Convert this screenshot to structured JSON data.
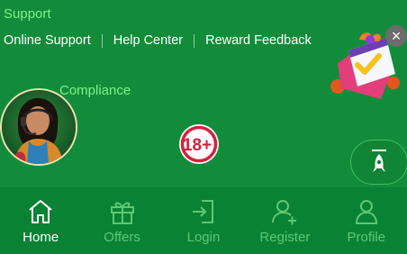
{
  "footer": {
    "support_title": "Support",
    "links": [
      {
        "label": "Online Support"
      },
      {
        "label": "Help Center"
      },
      {
        "label": "Reward Feedback"
      }
    ],
    "compliance_title": "Compliance"
  },
  "badge": {
    "text": "18+"
  },
  "tabs": [
    {
      "label": "Home",
      "icon": "home-icon",
      "active": true
    },
    {
      "label": "Offers",
      "icon": "gift-icon",
      "active": false
    },
    {
      "label": "Login",
      "icon": "login-icon",
      "active": false
    },
    {
      "label": "Register",
      "icon": "add-user-icon",
      "active": false
    },
    {
      "label": "Profile",
      "icon": "user-icon",
      "active": false
    }
  ],
  "colors": {
    "background": "#128c3a",
    "accent_text": "#7ff28a",
    "inactive_tab": "#5ec873",
    "active_tab": "#ffffff",
    "badge_red": "#d6213d"
  }
}
